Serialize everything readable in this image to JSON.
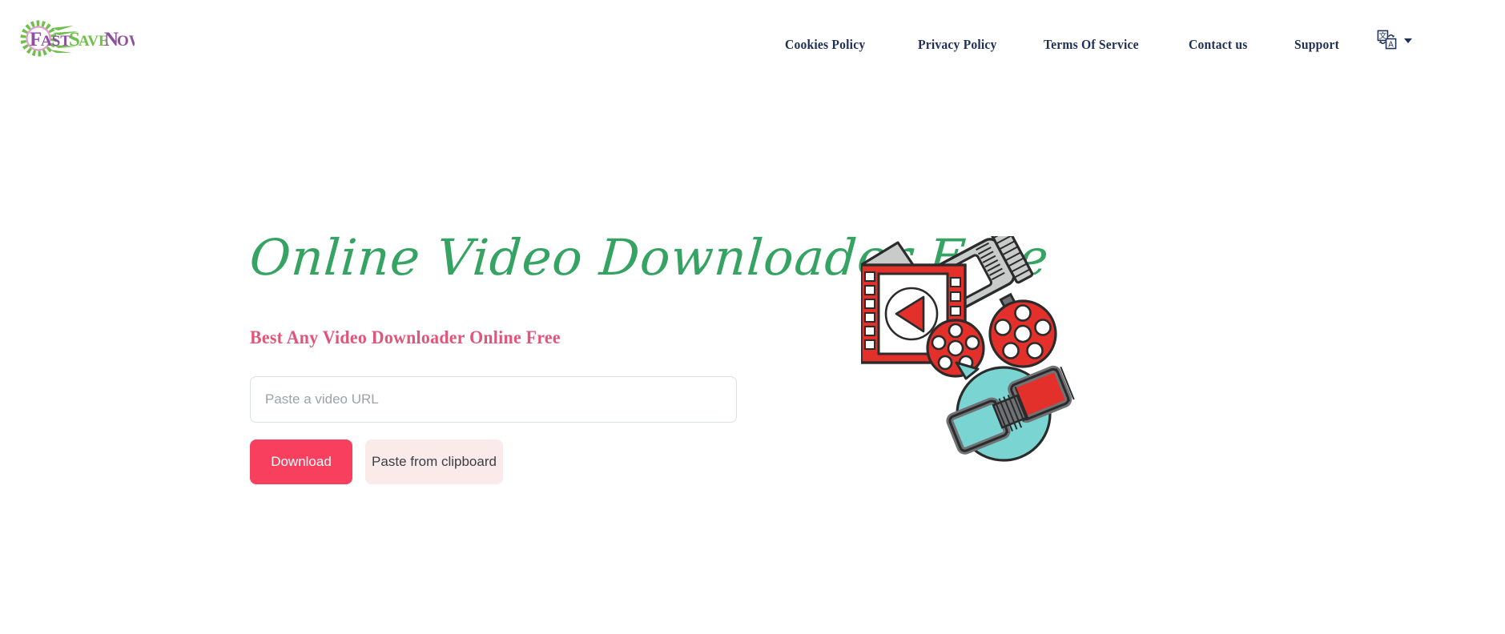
{
  "brand": {
    "name_part1": "Fast",
    "name_part2": "Save",
    "name_part3": "Now",
    "color_part1": "#8e4fa0",
    "color_part2": "#6fc04a",
    "color_part3": "#8e4fa0",
    "gear_color": "#6fc04a",
    "ring_color": "#e39ad0"
  },
  "nav": {
    "items": [
      {
        "label": "Cookies Policy"
      },
      {
        "label": "Privacy Policy"
      },
      {
        "label": "Terms Of Service"
      },
      {
        "label": "Contact us"
      },
      {
        "label": "Support"
      }
    ],
    "text_color": "#1f3057"
  },
  "language_switcher": {
    "icon": "translate-icon",
    "glyph_source": "文",
    "glyph_target": "A",
    "caret": "chevron-down-icon"
  },
  "hero": {
    "title": "Online Video Downloader Free",
    "title_color": "#35a362",
    "subtitle": "Best Any Video Downloader Online Free",
    "subtitle_color": "#e1557a"
  },
  "form": {
    "url_value": "",
    "url_placeholder": "Paste a video URL",
    "download_label": "Download",
    "download_bg": "#f8405e",
    "paste_label": "Paste from clipboard",
    "paste_bg": "#fbeaea"
  },
  "illustration": {
    "name": "video-downloader-illustration",
    "red": "#e4302a",
    "red_dark": "#c52520",
    "gray": "#c9cbcb",
    "gray_dark": "#6f7376",
    "teal": "#7ad4d2",
    "outline": "#2b2b2b",
    "elements": [
      "film-frame-with-play-button",
      "film-projector",
      "film-reel-small",
      "film-reel-large",
      "teal-speech-bubble-with-filmstrip"
    ]
  }
}
